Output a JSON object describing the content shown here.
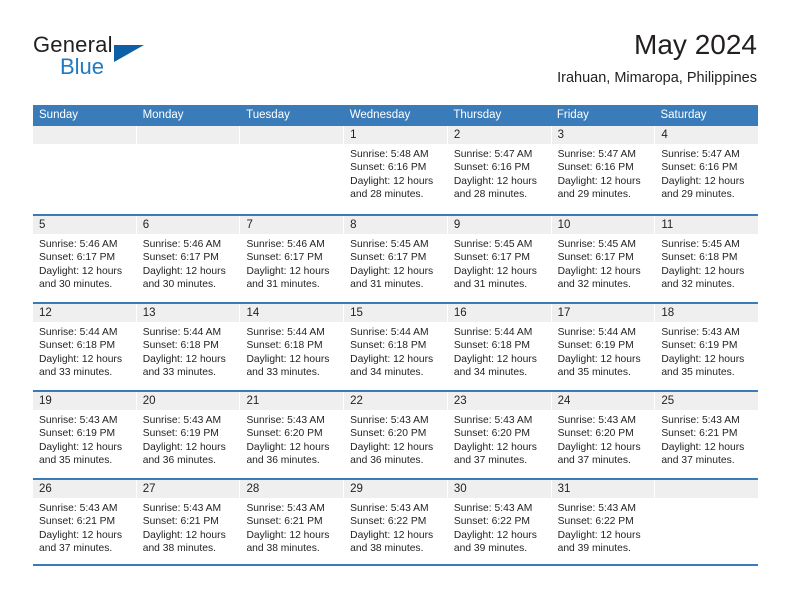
{
  "brand": {
    "name_top": "General",
    "name_bottom": "Blue",
    "accent_color": "#0d5fa6",
    "blue_text_color": "#1f7ac4"
  },
  "header": {
    "title": "May 2024",
    "subtitle": "Irahuan, Mimaropa, Philippines"
  },
  "theme": {
    "header_blue": "#3a7cba",
    "daynum_band": "#efefef",
    "text": "#231f20"
  },
  "weekdays": [
    "Sunday",
    "Monday",
    "Tuesday",
    "Wednesday",
    "Thursday",
    "Friday",
    "Saturday"
  ],
  "weeks": [
    [
      {
        "day": "",
        "empty": true,
        "sunrise": "",
        "sunset": "",
        "daylight1": "",
        "daylight2": ""
      },
      {
        "day": "",
        "empty": true,
        "sunrise": "",
        "sunset": "",
        "daylight1": "",
        "daylight2": ""
      },
      {
        "day": "",
        "empty": true,
        "sunrise": "",
        "sunset": "",
        "daylight1": "",
        "daylight2": ""
      },
      {
        "day": "1",
        "empty": false,
        "sunrise": "Sunrise: 5:48 AM",
        "sunset": "Sunset: 6:16 PM",
        "daylight1": "Daylight: 12 hours",
        "daylight2": "and 28 minutes."
      },
      {
        "day": "2",
        "empty": false,
        "sunrise": "Sunrise: 5:47 AM",
        "sunset": "Sunset: 6:16 PM",
        "daylight1": "Daylight: 12 hours",
        "daylight2": "and 28 minutes."
      },
      {
        "day": "3",
        "empty": false,
        "sunrise": "Sunrise: 5:47 AM",
        "sunset": "Sunset: 6:16 PM",
        "daylight1": "Daylight: 12 hours",
        "daylight2": "and 29 minutes."
      },
      {
        "day": "4",
        "empty": false,
        "sunrise": "Sunrise: 5:47 AM",
        "sunset": "Sunset: 6:16 PM",
        "daylight1": "Daylight: 12 hours",
        "daylight2": "and 29 minutes."
      }
    ],
    [
      {
        "day": "5",
        "empty": false,
        "sunrise": "Sunrise: 5:46 AM",
        "sunset": "Sunset: 6:17 PM",
        "daylight1": "Daylight: 12 hours",
        "daylight2": "and 30 minutes."
      },
      {
        "day": "6",
        "empty": false,
        "sunrise": "Sunrise: 5:46 AM",
        "sunset": "Sunset: 6:17 PM",
        "daylight1": "Daylight: 12 hours",
        "daylight2": "and 30 minutes."
      },
      {
        "day": "7",
        "empty": false,
        "sunrise": "Sunrise: 5:46 AM",
        "sunset": "Sunset: 6:17 PM",
        "daylight1": "Daylight: 12 hours",
        "daylight2": "and 31 minutes."
      },
      {
        "day": "8",
        "empty": false,
        "sunrise": "Sunrise: 5:45 AM",
        "sunset": "Sunset: 6:17 PM",
        "daylight1": "Daylight: 12 hours",
        "daylight2": "and 31 minutes."
      },
      {
        "day": "9",
        "empty": false,
        "sunrise": "Sunrise: 5:45 AM",
        "sunset": "Sunset: 6:17 PM",
        "daylight1": "Daylight: 12 hours",
        "daylight2": "and 31 minutes."
      },
      {
        "day": "10",
        "empty": false,
        "sunrise": "Sunrise: 5:45 AM",
        "sunset": "Sunset: 6:17 PM",
        "daylight1": "Daylight: 12 hours",
        "daylight2": "and 32 minutes."
      },
      {
        "day": "11",
        "empty": false,
        "sunrise": "Sunrise: 5:45 AM",
        "sunset": "Sunset: 6:18 PM",
        "daylight1": "Daylight: 12 hours",
        "daylight2": "and 32 minutes."
      }
    ],
    [
      {
        "day": "12",
        "empty": false,
        "sunrise": "Sunrise: 5:44 AM",
        "sunset": "Sunset: 6:18 PM",
        "daylight1": "Daylight: 12 hours",
        "daylight2": "and 33 minutes."
      },
      {
        "day": "13",
        "empty": false,
        "sunrise": "Sunrise: 5:44 AM",
        "sunset": "Sunset: 6:18 PM",
        "daylight1": "Daylight: 12 hours",
        "daylight2": "and 33 minutes."
      },
      {
        "day": "14",
        "empty": false,
        "sunrise": "Sunrise: 5:44 AM",
        "sunset": "Sunset: 6:18 PM",
        "daylight1": "Daylight: 12 hours",
        "daylight2": "and 33 minutes."
      },
      {
        "day": "15",
        "empty": false,
        "sunrise": "Sunrise: 5:44 AM",
        "sunset": "Sunset: 6:18 PM",
        "daylight1": "Daylight: 12 hours",
        "daylight2": "and 34 minutes."
      },
      {
        "day": "16",
        "empty": false,
        "sunrise": "Sunrise: 5:44 AM",
        "sunset": "Sunset: 6:18 PM",
        "daylight1": "Daylight: 12 hours",
        "daylight2": "and 34 minutes."
      },
      {
        "day": "17",
        "empty": false,
        "sunrise": "Sunrise: 5:44 AM",
        "sunset": "Sunset: 6:19 PM",
        "daylight1": "Daylight: 12 hours",
        "daylight2": "and 35 minutes."
      },
      {
        "day": "18",
        "empty": false,
        "sunrise": "Sunrise: 5:43 AM",
        "sunset": "Sunset: 6:19 PM",
        "daylight1": "Daylight: 12 hours",
        "daylight2": "and 35 minutes."
      }
    ],
    [
      {
        "day": "19",
        "empty": false,
        "sunrise": "Sunrise: 5:43 AM",
        "sunset": "Sunset: 6:19 PM",
        "daylight1": "Daylight: 12 hours",
        "daylight2": "and 35 minutes."
      },
      {
        "day": "20",
        "empty": false,
        "sunrise": "Sunrise: 5:43 AM",
        "sunset": "Sunset: 6:19 PM",
        "daylight1": "Daylight: 12 hours",
        "daylight2": "and 36 minutes."
      },
      {
        "day": "21",
        "empty": false,
        "sunrise": "Sunrise: 5:43 AM",
        "sunset": "Sunset: 6:20 PM",
        "daylight1": "Daylight: 12 hours",
        "daylight2": "and 36 minutes."
      },
      {
        "day": "22",
        "empty": false,
        "sunrise": "Sunrise: 5:43 AM",
        "sunset": "Sunset: 6:20 PM",
        "daylight1": "Daylight: 12 hours",
        "daylight2": "and 36 minutes."
      },
      {
        "day": "23",
        "empty": false,
        "sunrise": "Sunrise: 5:43 AM",
        "sunset": "Sunset: 6:20 PM",
        "daylight1": "Daylight: 12 hours",
        "daylight2": "and 37 minutes."
      },
      {
        "day": "24",
        "empty": false,
        "sunrise": "Sunrise: 5:43 AM",
        "sunset": "Sunset: 6:20 PM",
        "daylight1": "Daylight: 12 hours",
        "daylight2": "and 37 minutes."
      },
      {
        "day": "25",
        "empty": false,
        "sunrise": "Sunrise: 5:43 AM",
        "sunset": "Sunset: 6:21 PM",
        "daylight1": "Daylight: 12 hours",
        "daylight2": "and 37 minutes."
      }
    ],
    [
      {
        "day": "26",
        "empty": false,
        "sunrise": "Sunrise: 5:43 AM",
        "sunset": "Sunset: 6:21 PM",
        "daylight1": "Daylight: 12 hours",
        "daylight2": "and 37 minutes."
      },
      {
        "day": "27",
        "empty": false,
        "sunrise": "Sunrise: 5:43 AM",
        "sunset": "Sunset: 6:21 PM",
        "daylight1": "Daylight: 12 hours",
        "daylight2": "and 38 minutes."
      },
      {
        "day": "28",
        "empty": false,
        "sunrise": "Sunrise: 5:43 AM",
        "sunset": "Sunset: 6:21 PM",
        "daylight1": "Daylight: 12 hours",
        "daylight2": "and 38 minutes."
      },
      {
        "day": "29",
        "empty": false,
        "sunrise": "Sunrise: 5:43 AM",
        "sunset": "Sunset: 6:22 PM",
        "daylight1": "Daylight: 12 hours",
        "daylight2": "and 38 minutes."
      },
      {
        "day": "30",
        "empty": false,
        "sunrise": "Sunrise: 5:43 AM",
        "sunset": "Sunset: 6:22 PM",
        "daylight1": "Daylight: 12 hours",
        "daylight2": "and 39 minutes."
      },
      {
        "day": "31",
        "empty": false,
        "sunrise": "Sunrise: 5:43 AM",
        "sunset": "Sunset: 6:22 PM",
        "daylight1": "Daylight: 12 hours",
        "daylight2": "and 39 minutes."
      },
      {
        "day": "",
        "empty": true,
        "sunrise": "",
        "sunset": "",
        "daylight1": "",
        "daylight2": ""
      }
    ]
  ]
}
